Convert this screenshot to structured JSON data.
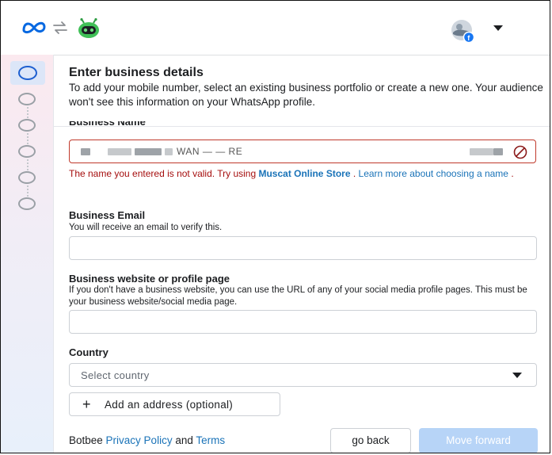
{
  "header": {
    "icons": [
      "meta-logo",
      "swap-arrows-icon",
      "bot-avatar",
      "profile-avatar-with-facebook-badge",
      "caret-down-icon"
    ]
  },
  "stepper": {
    "steps": [
      {
        "state": "active"
      },
      {
        "state": "pending"
      },
      {
        "state": "pending"
      },
      {
        "state": "pending"
      },
      {
        "state": "pending"
      },
      {
        "state": "pending"
      }
    ]
  },
  "page": {
    "title": "Enter business details",
    "intro": "To add your mobile number, select an existing business portfolio or create a new one. Your audience won't see this information on your WhatsApp profile."
  },
  "business_name": {
    "label": "Business Name",
    "value_visible": "— —  ————— — —  — — —",
    "typed_fragment": "WAN — — RE",
    "error_prefix": "The name you entered is not valid. Try using ",
    "suggestion": "Muscat Online Store",
    "error_mid": " . ",
    "learn_more": "Learn more about choosing a name",
    "error_suffix": " .",
    "error_color": "#a50e0e"
  },
  "business_email": {
    "label": "Business Email",
    "help": "You will receive an email to verify this.",
    "value": "",
    "placeholder": ""
  },
  "business_website": {
    "label": "Business website or profile page",
    "help": "If you don't have a business website, you can use the URL of any of your social media profile pages. This must be your business website/social media page.",
    "value": "",
    "placeholder": ""
  },
  "country": {
    "label": "Country",
    "selected": "Select country"
  },
  "add_address": {
    "label": "Add an address (optional)"
  },
  "footer": {
    "app_name": "Botbee ",
    "privacy": "Privacy Policy",
    "and": " and ",
    "terms": "Terms",
    "back_label": "go back",
    "forward_label": "Move forward"
  },
  "colors": {
    "accent": "#1a73b8",
    "disabled_primary": "#b7d4f7",
    "error": "#c0392b"
  }
}
